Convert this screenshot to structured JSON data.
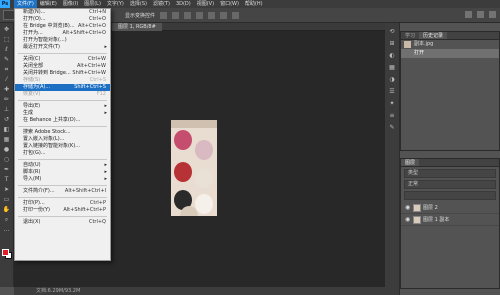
{
  "menubar": {
    "logo": "Ps",
    "items": [
      "文件(F)",
      "编辑(E)",
      "图像(I)",
      "图层(L)",
      "文字(Y)",
      "选择(S)",
      "滤镜(T)",
      "3D(D)",
      "视图(V)",
      "窗口(W)",
      "帮助(H)"
    ]
  },
  "options": {
    "label": "显示变换控件"
  },
  "doc_tab": {
    "title": "图层 1, RGB/8#"
  },
  "status": {
    "text": "文档:6.29M/93.2M"
  },
  "file_menu": [
    {
      "label": "新建(N)...",
      "shortcut": "Ctrl+N"
    },
    {
      "label": "打开(O)...",
      "shortcut": "Ctrl+O"
    },
    {
      "label": "在 Bridge 中浏览(B)...",
      "shortcut": "Alt+Ctrl+O"
    },
    {
      "label": "打开为...",
      "shortcut": "Alt+Shift+Ctrl+O"
    },
    {
      "label": "打开为智能对象(...)",
      "shortcut": ""
    },
    {
      "label": "最近打开文件(T)",
      "shortcut": "",
      "arrow": true
    },
    {
      "sep": true
    },
    {
      "label": "关闭(C)",
      "shortcut": "Ctrl+W"
    },
    {
      "label": "关闭全部",
      "shortcut": "Alt+Ctrl+W"
    },
    {
      "label": "关闭并转到 Bridge...",
      "shortcut": "Shift+Ctrl+W"
    },
    {
      "label": "存储(S)",
      "shortcut": "Ctrl+S",
      "disabled": true
    },
    {
      "label": "存储为(A)...",
      "shortcut": "Shift+Ctrl+S",
      "highlight": true
    },
    {
      "label": "恢复(V)",
      "shortcut": "F12",
      "disabled": true
    },
    {
      "sep": true
    },
    {
      "label": "导出(E)",
      "shortcut": "",
      "arrow": true
    },
    {
      "label": "生成",
      "shortcut": "",
      "arrow": true
    },
    {
      "label": "在 Behance 上共享(D)...",
      "shortcut": ""
    },
    {
      "sep": true
    },
    {
      "label": "搜索 Adobe Stock...",
      "shortcut": ""
    },
    {
      "label": "置入嵌入对象(L)...",
      "shortcut": ""
    },
    {
      "label": "置入链接的智能对象(K)...",
      "shortcut": ""
    },
    {
      "label": "打包(G)...",
      "shortcut": ""
    },
    {
      "sep": true
    },
    {
      "label": "自动(U)",
      "shortcut": "",
      "arrow": true
    },
    {
      "label": "脚本(R)",
      "shortcut": "",
      "arrow": true
    },
    {
      "label": "导入(M)",
      "shortcut": "",
      "arrow": true
    },
    {
      "sep": true
    },
    {
      "label": "文件简介(F)...",
      "shortcut": "Alt+Shift+Ctrl+I"
    },
    {
      "sep": true
    },
    {
      "label": "打印(P)...",
      "shortcut": "Ctrl+P"
    },
    {
      "label": "打印一份(Y)",
      "shortcut": "Alt+Shift+Ctrl+P"
    },
    {
      "sep": true
    },
    {
      "label": "退出(X)",
      "shortcut": "Ctrl+Q"
    }
  ],
  "history_panel": {
    "tabs": [
      "学习",
      "历史记录"
    ],
    "items": [
      "副本.jpg",
      "打开"
    ]
  },
  "layers_panel": {
    "tabs": [
      "图层"
    ],
    "kind_filter": "类型",
    "blend_mode": "正常",
    "layers": [
      "图层 2",
      "图层 1 副本"
    ]
  }
}
